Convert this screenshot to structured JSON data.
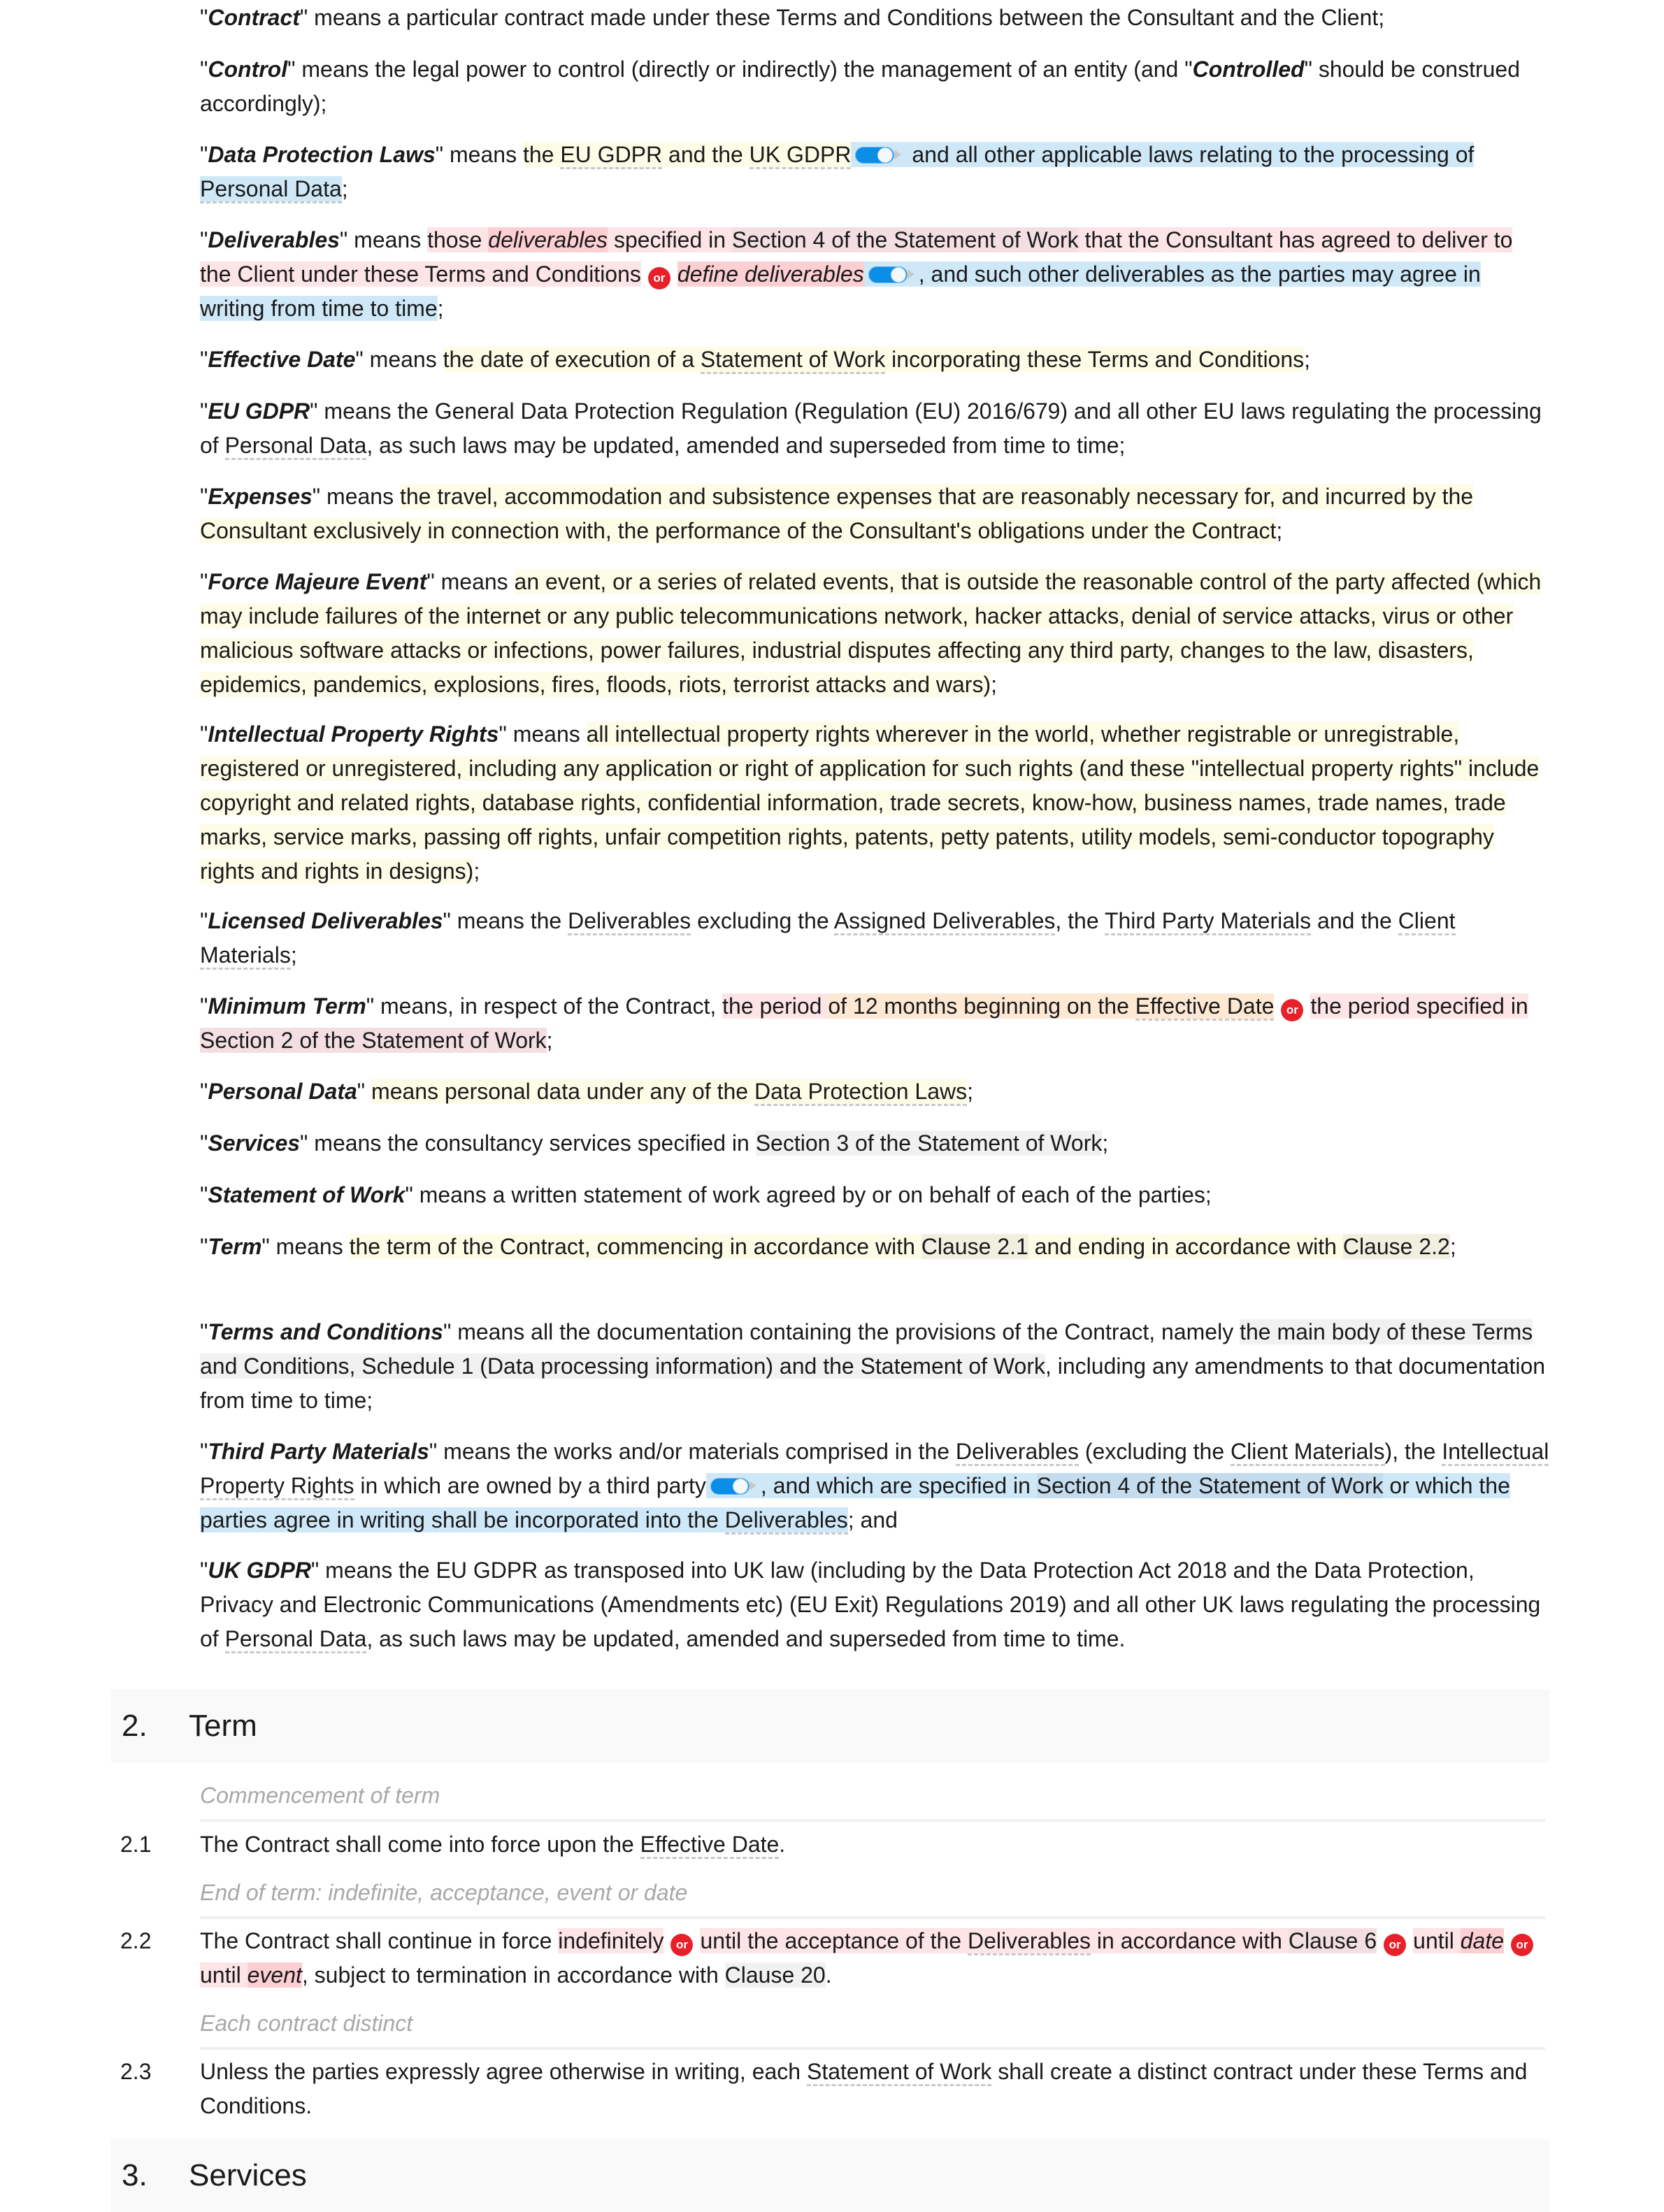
{
  "definitions": [
    {
      "term": "Contract",
      "parts": [
        "\" means a particular contract made under these Terms and Conditions between the Consultant and the Client;"
      ]
    },
    {
      "term": "Control",
      "parts": [
        "\" means the legal power to control (directly or indirectly) the management of an entity (and \"",
        "Controlled",
        "\" should be construed accordingly);"
      ]
    },
    {
      "term": "Data Protection Laws",
      "parts": [
        "\" means ",
        "the ",
        "EU GDPR",
        " and the ",
        "UK GDPR",
        " and all other applicable laws relating to the processing of ",
        "Personal Data",
        ";"
      ]
    },
    {
      "term": "Deliverables",
      "parts": [
        "\" means ",
        "those ",
        "deliverables",
        " specified in ",
        "Section 4 of the Statement of Work",
        " that the Consultant has agreed to deliver to the Client under these Terms and Conditions",
        "or",
        "define deliverables",
        ", and such other deliverables as the parties may agree in writing from time to time",
        ";"
      ]
    },
    {
      "term": "Effective Date",
      "parts": [
        "\" means ",
        "the date of execution of a ",
        "Statement of Work",
        " incorporating these Terms and Conditions",
        ";"
      ]
    },
    {
      "term": "EU GDPR",
      "parts": [
        "\" means the General Data Protection Regulation (Regulation (EU) 2016/679) and all other EU laws regulating the processing of ",
        "Personal Data",
        ", as such laws may be updated, amended and superseded from time to time;"
      ]
    },
    {
      "term": "Expenses",
      "parts": [
        "\" means ",
        "the travel, accommodation and subsistence expenses that are reasonably necessary for, and incurred by the Consultant exclusively in connection with, the performance of the Consultant's obligations under the Contract",
        ";"
      ]
    },
    {
      "term": "Force Majeure Event",
      "parts": [
        "\" means ",
        "an event, or a series of related events, that is outside the reasonable control of the party affected (which may include failures of the internet or any public telecommunications network, hacker attacks, denial of service attacks, virus or other malicious software attacks or infections, power failures, industrial disputes affecting any third party, changes to the law, disasters, epidemics, pandemics, explosions, fires, floods, riots, terrorist attacks and wars)",
        ";"
      ]
    },
    {
      "term": "Intellectual Property Rights",
      "parts": [
        "\" means ",
        "all intellectual property rights wherever in the world, whether registrable or unregistrable, registered or unregistered, including any application or right of application for such rights (and these \"intellectual property rights\" include copyright and related rights, database rights, confidential information, trade secrets, know-how, business names, trade names, trade marks, service marks, passing off rights, unfair competition rights, patents, petty patents, utility models, semi-conductor topography rights and rights in designs)",
        ";"
      ]
    },
    {
      "term": "Licensed Deliverables",
      "parts": [
        "\" means the ",
        "Deliverables",
        " excluding the ",
        "Assigned Deliverables",
        ", the ",
        "Third Party Materials",
        " and the ",
        "Client Materials",
        ";"
      ]
    },
    {
      "term": "Minimum Term",
      "parts": [
        "\" means, in respect of the Contract, ",
        "the period ",
        "of 12 months beginning on the ",
        "Effective Date",
        "or",
        "the period specified in ",
        "Section 2 of the Statement of Work",
        ";"
      ]
    },
    {
      "term": "Personal Data",
      "parts": [
        "\" ",
        "means personal data under any of the ",
        "Data Protection Laws",
        ";"
      ]
    },
    {
      "term": "Services",
      "parts": [
        "\" means the consultancy services specified in ",
        "Section 3 of the Statement of Work",
        ";"
      ]
    },
    {
      "term": "Statement of Work",
      "parts": [
        "\" means a written statement of work agreed by or on behalf of each of the parties;"
      ]
    },
    {
      "term": "Term",
      "parts": [
        "\" means ",
        "the term of the Contract, commencing in accordance with ",
        "Clause 2.1",
        " and ending in accordance with ",
        "Clause 2.2",
        ";"
      ]
    },
    {
      "term": "Terms and Conditions",
      "parts": [
        "\" means all the documentation containing the provisions of the Contract, namely ",
        "the main body of these Terms and Conditions, Schedule 1 (Data processing information) and the Statement of Work",
        ", including any amendments to that documentation from time to time;"
      ]
    },
    {
      "term": "Third Party Materials",
      "parts": [
        "\" means the works and/or materials comprised in the ",
        "Deliverables",
        " (excluding the ",
        "Client Materials",
        "), the ",
        "Intellectual Property Rights",
        " in which are owned by a third party",
        ", and which are specified in ",
        "Section 4 of the Statement of Work",
        " or which the parties agree in writing shall be incorporated into the ",
        "Deliverables",
        "; and"
      ]
    },
    {
      "term": "UK GDPR",
      "parts": [
        "\" means the EU GDPR as transposed into UK law (including by the Data Protection Act 2018 and the Data Protection, Privacy and Electronic Communications (Amendments etc) (EU Exit) Regulations 2019) and all other UK laws regulating the processing of ",
        "Personal Data",
        ", as such laws may be updated, amended and superseded from time to time."
      ]
    }
  ],
  "section2": {
    "number": "2.",
    "title": "Term",
    "clauses": [
      {
        "subheading": "Commencement of term",
        "number": "2.1",
        "parts": [
          "The Contract shall come into force upon the ",
          "Effective Date",
          "."
        ]
      },
      {
        "subheading": "End of term: indefinite, acceptance, event or date",
        "number": "2.2",
        "parts": [
          "The Contract shall continue in force ",
          "indefinitely",
          "or",
          "until the acceptance of the ",
          "Deliverables",
          " in accordance with ",
          "Clause 6",
          "or",
          "until ",
          "date",
          "or",
          "until ",
          "event",
          ", subject to termination in accordance with ",
          "Clause 20",
          "."
        ]
      },
      {
        "subheading": "Each contract distinct",
        "number": "2.3",
        "parts": [
          "Unless the parties expressly agree otherwise in writing, each ",
          "Statement of Work",
          " shall create a distinct contract under these Terms and Conditions."
        ]
      }
    ]
  },
  "section3": {
    "number": "3.",
    "title": "Services"
  },
  "icons": {
    "toggle": "toggle-switch-icon",
    "or": "or-badge"
  },
  "colors": {
    "or_badge": "#e8202a",
    "toggle": "#0a8ee6",
    "optional_highlight": "#cfe8f8",
    "alternative_highlight": "#fde4e6",
    "editable_highlight": "#fdfce6"
  }
}
